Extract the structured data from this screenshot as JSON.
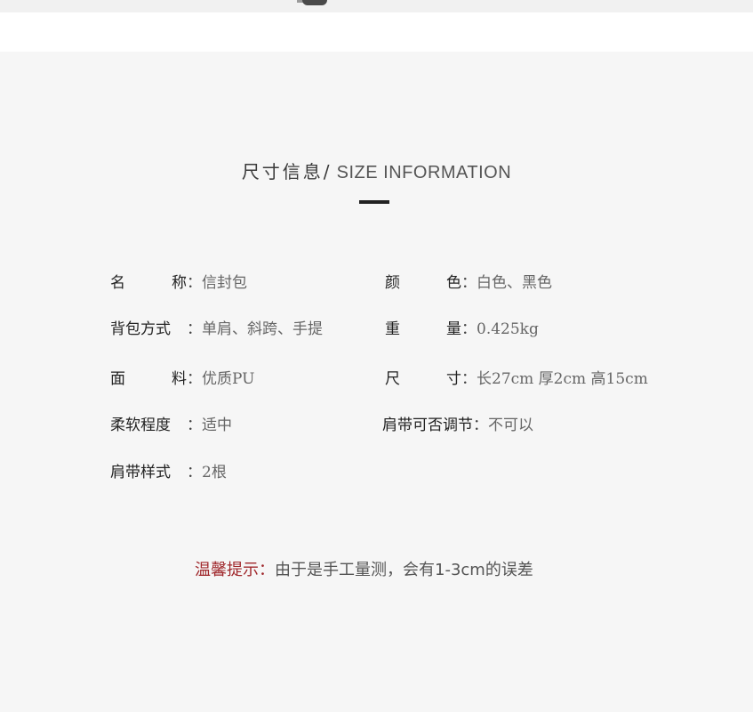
{
  "header": {
    "title_cn": "尺寸信息/",
    "title_en": "SIZE INFORMATION"
  },
  "specs": {
    "name": {
      "label": "名　称",
      "colon": "：",
      "value": "信封包"
    },
    "color": {
      "label": "颜　色",
      "colon": "：",
      "value": "白色、黑色"
    },
    "carry": {
      "label": "背包方式",
      "colon": "：",
      "value": "单肩、斜跨、手提"
    },
    "weight": {
      "label": "重　量",
      "colon": "：",
      "value": "0.425kg"
    },
    "material": {
      "label": "面　料",
      "colon": "：",
      "value": "优质PU"
    },
    "size": {
      "label": "尺　寸",
      "colon": "：",
      "value": "长27cm 厚2cm 高15cm"
    },
    "softness": {
      "label": "柔软程度",
      "colon": "：",
      "value": "适中"
    },
    "adjustable": {
      "label": "肩带可否调节",
      "colon": "：",
      "value": "不可以"
    },
    "strap_style": {
      "label": "肩带样式",
      "colon": "：",
      "value": "2根"
    }
  },
  "tip": {
    "label": "温馨提示：",
    "text": "由于是手工量测，会有1-3cm的误差"
  },
  "colors": {
    "tip_label": "#a0282c",
    "panel_bg": "#f6f6f6"
  }
}
